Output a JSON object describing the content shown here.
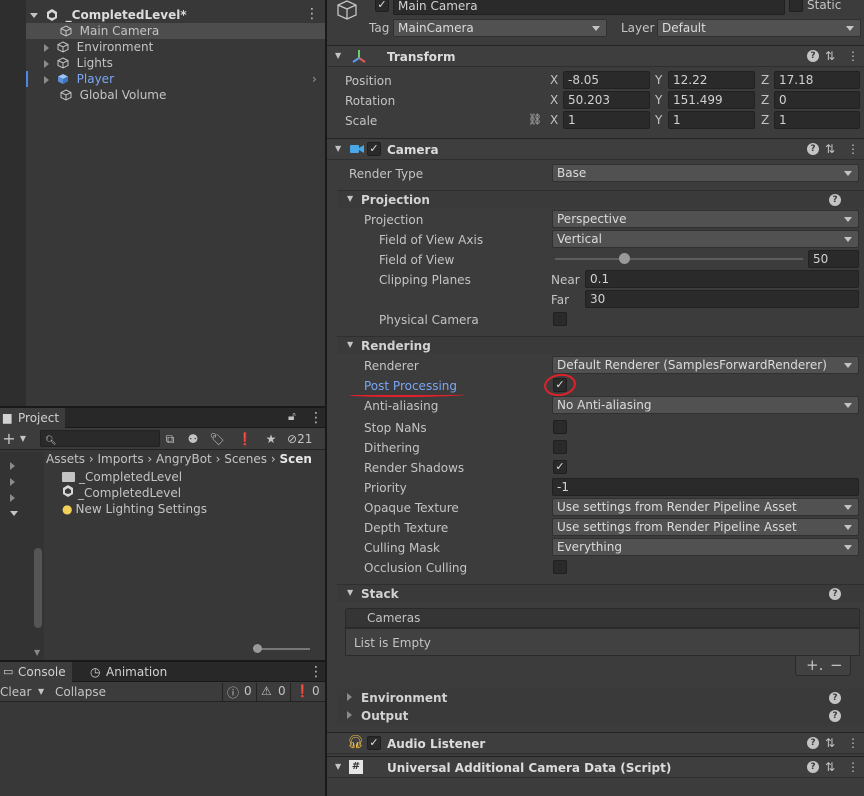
{
  "hierarchy": {
    "scene_name": "_CompletedLevel*",
    "items": [
      {
        "label": "Main Camera"
      },
      {
        "label": "Environment"
      },
      {
        "label": "Lights"
      },
      {
        "label": "Player"
      },
      {
        "label": "Global Volume"
      }
    ]
  },
  "project": {
    "tab_label": "Project",
    "badge_count": "21",
    "breadcrumbs": [
      "Assets",
      "Imports",
      "AngryBot",
      "Scenes",
      "Scen"
    ],
    "items": [
      {
        "label": "_CompletedLevel"
      },
      {
        "label": "_CompletedLevel"
      },
      {
        "label": "New Lighting Settings"
      }
    ]
  },
  "console": {
    "tabs": [
      "Console",
      "Animation"
    ],
    "clear_label": "Clear",
    "collapse_label": "Collapse",
    "counts": {
      "info": "0",
      "warn": "0",
      "error": "0"
    }
  },
  "inspector": {
    "object_name": "Main Camera",
    "static_label": "Static",
    "tag_label": "Tag",
    "tag_value": "MainCamera",
    "layer_label": "Layer",
    "layer_value": "Default",
    "transform": {
      "title": "Transform",
      "position_label": "Position",
      "rotation_label": "Rotation",
      "scale_label": "Scale",
      "axis": [
        "X",
        "Y",
        "Z"
      ],
      "position": [
        "-8.05",
        "12.22",
        "17.18"
      ],
      "rotation": [
        "50.203",
        "151.499",
        "0"
      ],
      "scale": [
        "1",
        "1",
        "1"
      ]
    },
    "camera": {
      "title": "Camera",
      "render_type_label": "Render Type",
      "render_type_value": "Base",
      "projection_section": "Projection",
      "projection_label": "Projection",
      "projection_value": "Perspective",
      "fov_axis_label": "Field of View Axis",
      "fov_axis_value": "Vertical",
      "fov_label": "Field of View",
      "fov_value": "50",
      "fov_slider_fraction": 0.28,
      "clipping_label": "Clipping Planes",
      "near_label": "Near",
      "near_value": "0.1",
      "far_label": "Far",
      "far_value": "30",
      "physical_label": "Physical Camera",
      "rendering_section": "Rendering",
      "renderer_label": "Renderer",
      "renderer_value": "Default Renderer (SamplesForwardRenderer)",
      "post_label": "Post Processing",
      "aa_label": "Anti-aliasing",
      "aa_value": "No Anti-aliasing",
      "stop_nans_label": "Stop NaNs",
      "dithering_label": "Dithering",
      "shadows_label": "Render Shadows",
      "priority_label": "Priority",
      "priority_value": "-1",
      "opaque_label": "Opaque Texture",
      "opaque_value": "Use settings from Render Pipeline Asset",
      "depth_label": "Depth Texture",
      "depth_value": "Use settings from Render Pipeline Asset",
      "culling_label": "Culling Mask",
      "culling_value": "Everything",
      "occlusion_label": "Occlusion Culling",
      "stack_section": "Stack",
      "cameras_label": "Cameras",
      "empty_label": "List is Empty",
      "environment_section": "Environment",
      "output_section": "Output"
    },
    "audio_listener": "Audio Listener",
    "additional_data": "Universal Additional Camera Data (Script)"
  },
  "colors": {
    "accent_blue": "#7aa6f5",
    "annotation_red": "#e0202a"
  }
}
